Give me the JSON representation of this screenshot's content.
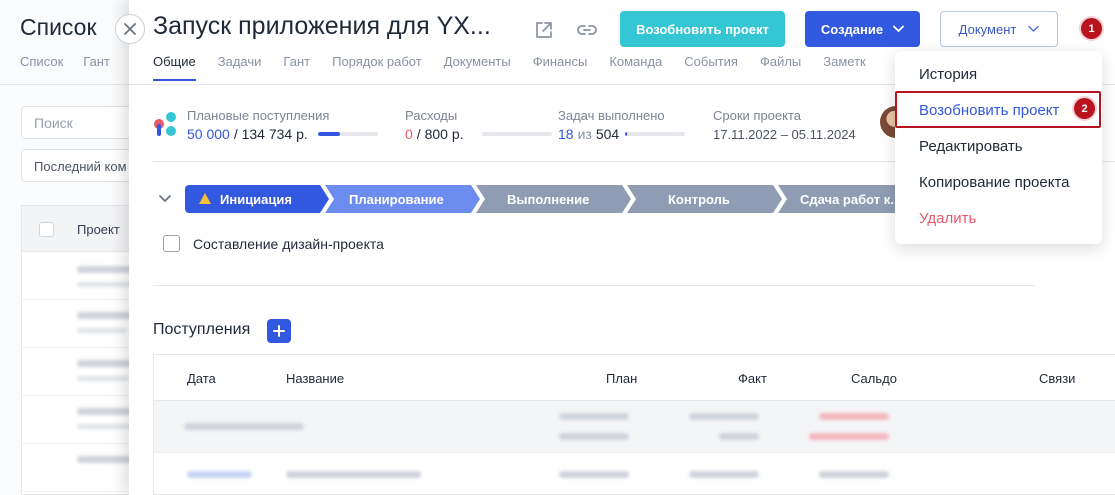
{
  "background": {
    "title": "Список",
    "tabs": [
      "Список",
      "Гант"
    ],
    "search_placeholder": "Поиск",
    "filter_value": "Последний ком",
    "table_header": "Проект"
  },
  "panel": {
    "title": "Запуск приложения для YX...",
    "resume_button": "Возобновить проект",
    "create_button": "Создание",
    "document_button": "Документ",
    "badge_1": "1",
    "tabs": [
      "Общие",
      "Задачи",
      "Гант",
      "Порядок работ",
      "Документы",
      "Финансы",
      "Команда",
      "События",
      "Файлы",
      "Заметк"
    ],
    "stats": {
      "income_label": "Плановые поступления",
      "income_value": "50 000",
      "income_total": "/ 134 734 р.",
      "income_progress": 0.37,
      "expenses_label": "Расходы",
      "expenses_value": "0",
      "expenses_total": "/ 800 р.",
      "expenses_progress": 0,
      "tasks_label": "Задач выполнено",
      "tasks_done": "18",
      "tasks_of": "из",
      "tasks_total": "504",
      "tasks_progress": 0.036,
      "dates_label": "Сроки проекта",
      "dates_value": "17.11.2022  –  05.11.2024"
    },
    "stages": [
      "Инициация",
      "Планирование",
      "Выполнение",
      "Контроль",
      "Сдача работ к..."
    ],
    "checklist_item": "Составление дизайн-проекта",
    "income_section": {
      "title": "Поступления",
      "columns": [
        "Дата",
        "Название",
        "План",
        "Факт",
        "Сальдо",
        "Связи"
      ]
    }
  },
  "dropdown": {
    "items": [
      "История",
      "Возобновить проект",
      "Редактировать",
      "Копирование проекта",
      "Удалить"
    ],
    "badge_2": "2"
  },
  "colors": {
    "accent": "#3358e0",
    "teal": "#34c6d3",
    "danger": "#e8596a",
    "badge": "#b8141f",
    "stage_active": "#3358e0",
    "stage_next": "#6d8cf0",
    "stage_inactive": "#8f9cb3"
  }
}
